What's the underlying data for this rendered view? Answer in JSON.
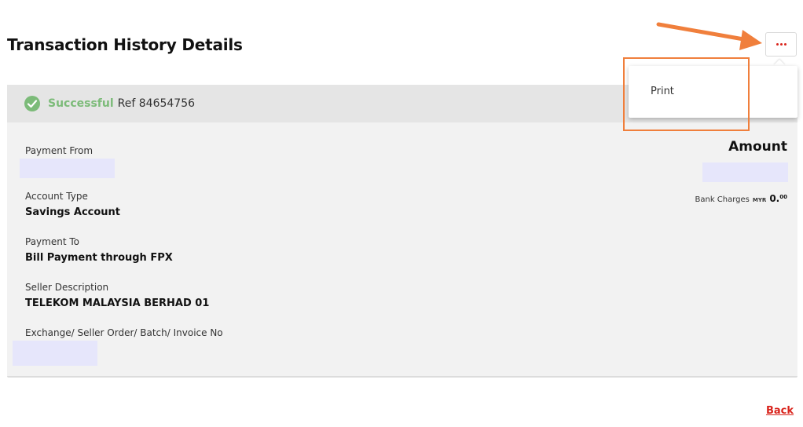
{
  "page": {
    "title": "Transaction History Details"
  },
  "menu": {
    "more_label": "More options",
    "items": [
      {
        "label": "Print"
      }
    ]
  },
  "transaction": {
    "status": "Successful",
    "ref": "Ref 84654756",
    "fields": {
      "payment_from_label": "Payment From",
      "account_type_label": "Account Type",
      "account_type_value": "Savings Account",
      "payment_to_label": "Payment To",
      "payment_to_value": "Bill Payment through FPX",
      "seller_description_label": "Seller Description",
      "seller_description_value": "TELEKOM MALAYSIA BERHAD 01",
      "order_no_label": "Exchange/ Seller Order/ Batch/ Invoice No"
    },
    "amount_label": "Amount",
    "bank_charges": {
      "label": "Bank Charges",
      "currency": "MYR",
      "integer": "0.",
      "decimal": "00"
    }
  },
  "footer": {
    "back_label": "Back"
  },
  "colors": {
    "accent_red": "#d9241c",
    "success_green": "#7cbb79",
    "annotation_orange": "#f07f3c",
    "redaction": "#e6e6fb"
  },
  "icons": [
    "check-circle-icon",
    "more-dots-icon",
    "annotation-arrow-icon"
  ]
}
